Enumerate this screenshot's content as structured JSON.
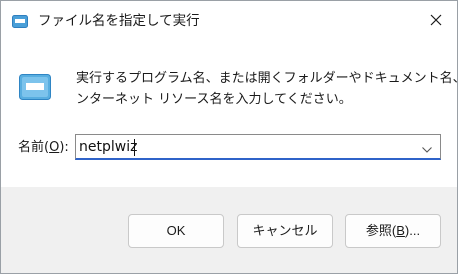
{
  "window": {
    "title": "ファイル名を指定して実行",
    "close_icon": "close-icon"
  },
  "description": {
    "line1": "実行するプログラム名、または開くフォルダーやドキュメント名、イ",
    "line2": "ンターネット リソース名を入力してください。"
  },
  "name_field": {
    "label_prefix": "名前(",
    "label_access_key": "O",
    "label_suffix": "):",
    "value": "netplwiz",
    "dropdown_icon": "chevron-down-icon"
  },
  "buttons": {
    "ok": "OK",
    "cancel": "キャンセル",
    "browse_prefix": "参照(",
    "browse_access_key": "B",
    "browse_suffix": ")..."
  },
  "icons": {
    "title": "run-dialog-icon",
    "main": "run-dialog-icon"
  },
  "colors": {
    "accent": "#2f63c9",
    "footer_bg": "#f0f0f0"
  }
}
